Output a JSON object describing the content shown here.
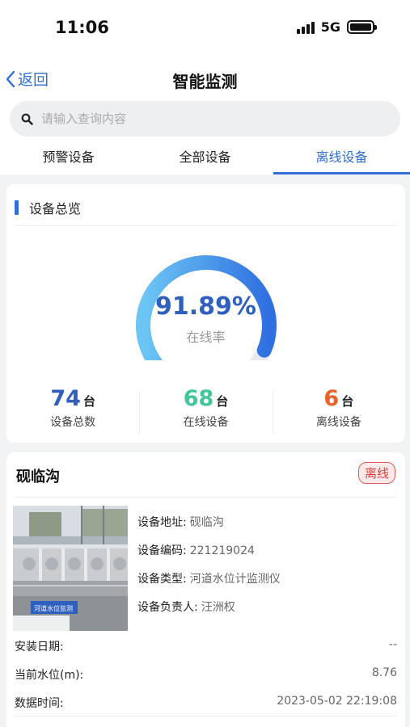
{
  "status": {
    "time": "11:06",
    "network": "5G"
  },
  "nav": {
    "back_label": "返回",
    "title": "智能监测"
  },
  "search": {
    "placeholder": "请输入查询内容"
  },
  "tabs": [
    {
      "label": "预警设备"
    },
    {
      "label": "全部设备"
    },
    {
      "label": "离线设备",
      "active": true
    }
  ],
  "overview": {
    "title": "设备总览",
    "rate": "91.89%",
    "rate_value": 0.9189,
    "rate_label": "在线率",
    "stats": [
      {
        "value": "74",
        "unit": "台",
        "label": "设备总数",
        "color": "#2f5fbf"
      },
      {
        "value": "68",
        "unit": "台",
        "label": "在线设备",
        "color": "#3ec79a"
      },
      {
        "value": "6",
        "unit": "台",
        "label": "离线设备",
        "color": "#e8622a"
      }
    ]
  },
  "device": {
    "name": "砚临沟",
    "status": "离线",
    "photo_sign": "河道水位监测",
    "address_label": "设备地址:",
    "address": "砚临沟",
    "code_label": "设备编码:",
    "code": "221219024",
    "type_label": "设备类型:",
    "type": "河道水位计监测仪",
    "owner_label": "设备负责人:",
    "owner": "汪洲权",
    "install_label": "安装日期:",
    "install": "--",
    "level_label": "当前水位(m):",
    "level": "8.76",
    "time_label": "数据时间:",
    "time": "2023-05-02 22:19:08"
  },
  "colors": {
    "accent": "#2f6fd6",
    "danger": "#d94040"
  }
}
